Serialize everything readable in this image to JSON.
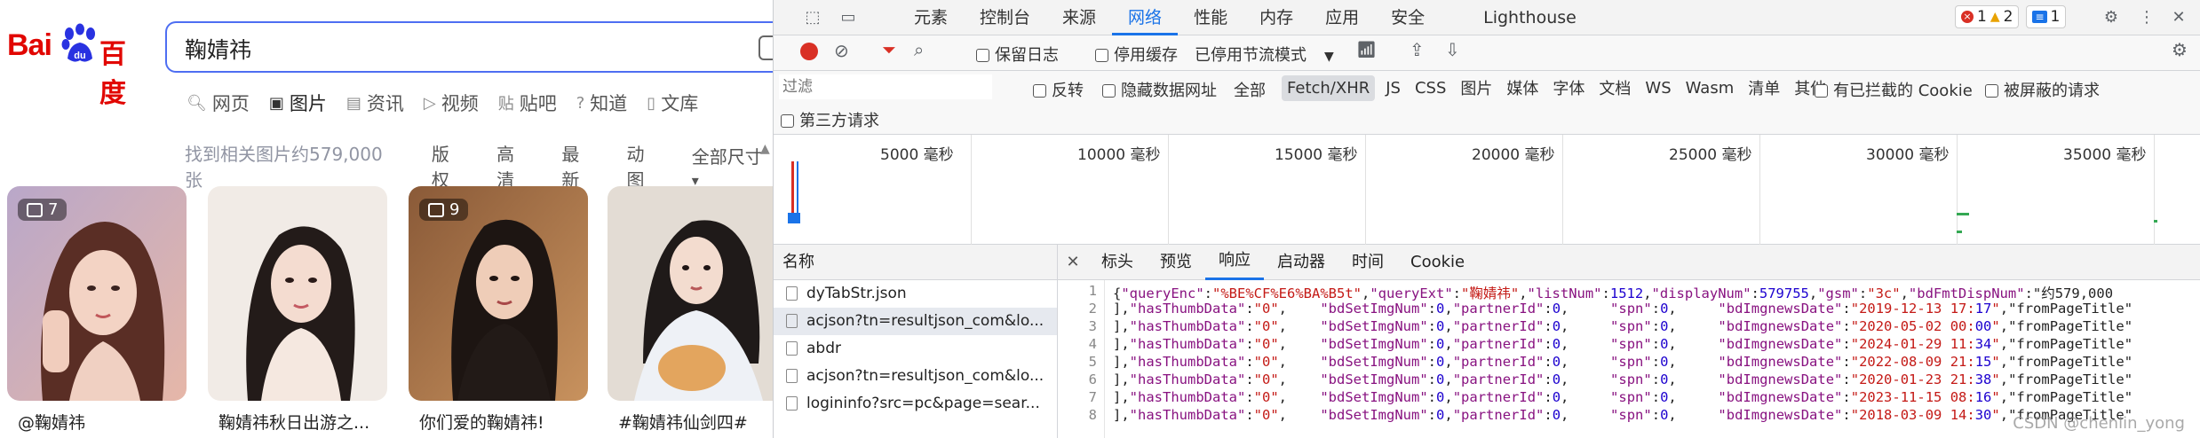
{
  "baidu": {
    "logo_text_left": "Bai",
    "logo_text_right": "百度",
    "search_value": "鞠婧祎",
    "tabs": [
      {
        "label": "网页",
        "icon": "search-icon"
      },
      {
        "label": "图片",
        "icon": "image-icon"
      },
      {
        "label": "资讯",
        "icon": "news-icon"
      },
      {
        "label": "视频",
        "icon": "video-icon"
      },
      {
        "label": "贴吧",
        "icon": "tieba-icon"
      },
      {
        "label": "知道",
        "icon": "question-icon"
      },
      {
        "label": "文库",
        "icon": "document-icon"
      }
    ],
    "result_count": "找到相关图片约579,000张",
    "filters": [
      "版权",
      "高清",
      "最新",
      "动图",
      "全部尺寸"
    ],
    "cards": [
      {
        "caption": "@鞠婧祎",
        "badge": "7"
      },
      {
        "caption": "鞠婧祎秋日出游之...",
        "badge": ""
      },
      {
        "caption": "你们爱的鞠婧祎!",
        "badge": "9"
      },
      {
        "caption": "#鞠婧祎仙剑四#",
        "badge": ""
      }
    ]
  },
  "devtools": {
    "tabs": [
      "元素",
      "控制台",
      "来源",
      "网络",
      "性能",
      "内存",
      "应用",
      "安全",
      "Lighthouse"
    ],
    "active_tab": "网络",
    "errors": "1",
    "warnings": "2",
    "messages": "1",
    "toolbar": {
      "preserve_log": "保留日志",
      "disable_cache": "停用缓存",
      "throttle": "已停用节流模式"
    },
    "filter_placeholder": "过滤",
    "invert": "反转",
    "hide_data_urls": "隐藏数据网址",
    "all": "全部",
    "types": [
      "Fetch/XHR",
      "JS",
      "CSS",
      "图片",
      "媒体",
      "字体",
      "文档",
      "WS",
      "Wasm",
      "清单",
      "其他"
    ],
    "blocked_cookies": "有已拦截的 Cookie",
    "blocked_requests": "被屏蔽的请求",
    "third_party": "第三方请求",
    "timeline_ticks": [
      "5000 毫秒",
      "10000 毫秒",
      "15000 毫秒",
      "20000 毫秒",
      "25000 毫秒",
      "30000 毫秒",
      "35000 毫秒"
    ],
    "name_header": "名称",
    "requests": [
      "dyTabStr.json",
      "acjson?tn=resultjson_com&lo...",
      "abdr",
      "acjson?tn=resultjson_com&lo...",
      "logininfo?src=pc&page=sear..."
    ],
    "detail_tabs": [
      "标头",
      "预览",
      "响应",
      "启动器",
      "时间",
      "Cookie"
    ],
    "active_detail_tab": "响应",
    "code_lines": [
      "{\"queryEnc\":\"%BE%CF%E6%BA%B5t\",\"queryExt\":\"鞠婧祎\",\"listNum\":1512,\"displayNum\":579755,\"gsm\":\"3c\",\"bdFmtDispNum\":\"约579,000",
      "],\"hasThumbData\":\"0\",    \"bdSetImgNum\":0,\"partnerId\":0,     \"spn\":0,     \"bdImgnewsDate\":\"2019-12-13 17:17\",\"fromPageTitle\"",
      "],\"hasThumbData\":\"0\",    \"bdSetImgNum\":0,\"partnerId\":0,     \"spn\":0,     \"bdImgnewsDate\":\"2020-05-02 00:00\",\"fromPageTitle\"",
      "],\"hasThumbData\":\"0\",    \"bdSetImgNum\":0,\"partnerId\":0,     \"spn\":0,     \"bdImgnewsDate\":\"2024-01-29 11:34\",\"fromPageTitle\"",
      "],\"hasThumbData\":\"0\",    \"bdSetImgNum\":0,\"partnerId\":0,     \"spn\":0,     \"bdImgnewsDate\":\"2022-08-09 21:15\",\"fromPageTitle\"",
      "],\"hasThumbData\":\"0\",    \"bdSetImgNum\":0,\"partnerId\":0,     \"spn\":0,     \"bdImgnewsDate\":\"2020-01-23 21:38\",\"fromPageTitle\"",
      "],\"hasThumbData\":\"0\",    \"bdSetImgNum\":0,\"partnerId\":0,     \"spn\":0,     \"bdImgnewsDate\":\"2023-11-15 08:16\",\"fromPageTitle\"",
      "],\"hasThumbData\":\"0\",    \"bdSetImgNum\":0,\"partnerId\":0,     \"spn\":0,     \"bdImgnewsDate\":\"2018-03-09 14:30\",\"fromPageTitle\""
    ],
    "watermark": "CSDN @chenlin_yong"
  }
}
